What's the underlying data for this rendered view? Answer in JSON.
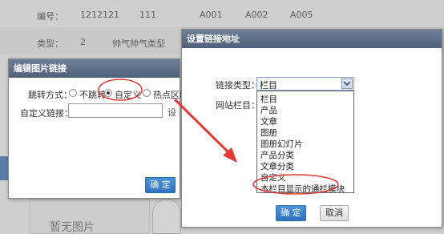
{
  "background": {
    "row1": {
      "label": "编号：",
      "values": [
        "1212121",
        "111",
        "A001",
        "A002",
        "A005"
      ]
    },
    "row2": {
      "label": "类型：",
      "values": [
        "2",
        "帅气帅气类型"
      ]
    },
    "no_image_text": "暂无图片"
  },
  "image_link_dialog": {
    "title": "编辑图片链接",
    "jump_label": "跳转方式：",
    "options": [
      "不跳转",
      "自定义",
      "热点区域"
    ],
    "selected_option": "自定义",
    "custom_link_label": "自定义链接：",
    "custom_link_value": "",
    "truncated_button": "设",
    "ok_button": "确 定"
  },
  "link_dialog": {
    "title": "设置链接地址",
    "link_type_label": "链接类型：",
    "link_type_value": "栏目",
    "site_column_label": "网站栏目：",
    "dropdown_items": [
      "栏目",
      "产品",
      "文章",
      "图册",
      "图册幻灯片",
      "产品分类",
      "文章分类",
      "自定义",
      "本栏目显示的通栏模块"
    ],
    "ok_button": "确 定",
    "cancel_button": "取消"
  },
  "colors": {
    "title_bar": "#5a6b84",
    "annotation_red": "#e53935",
    "primary_button": "#3a7fcc"
  }
}
